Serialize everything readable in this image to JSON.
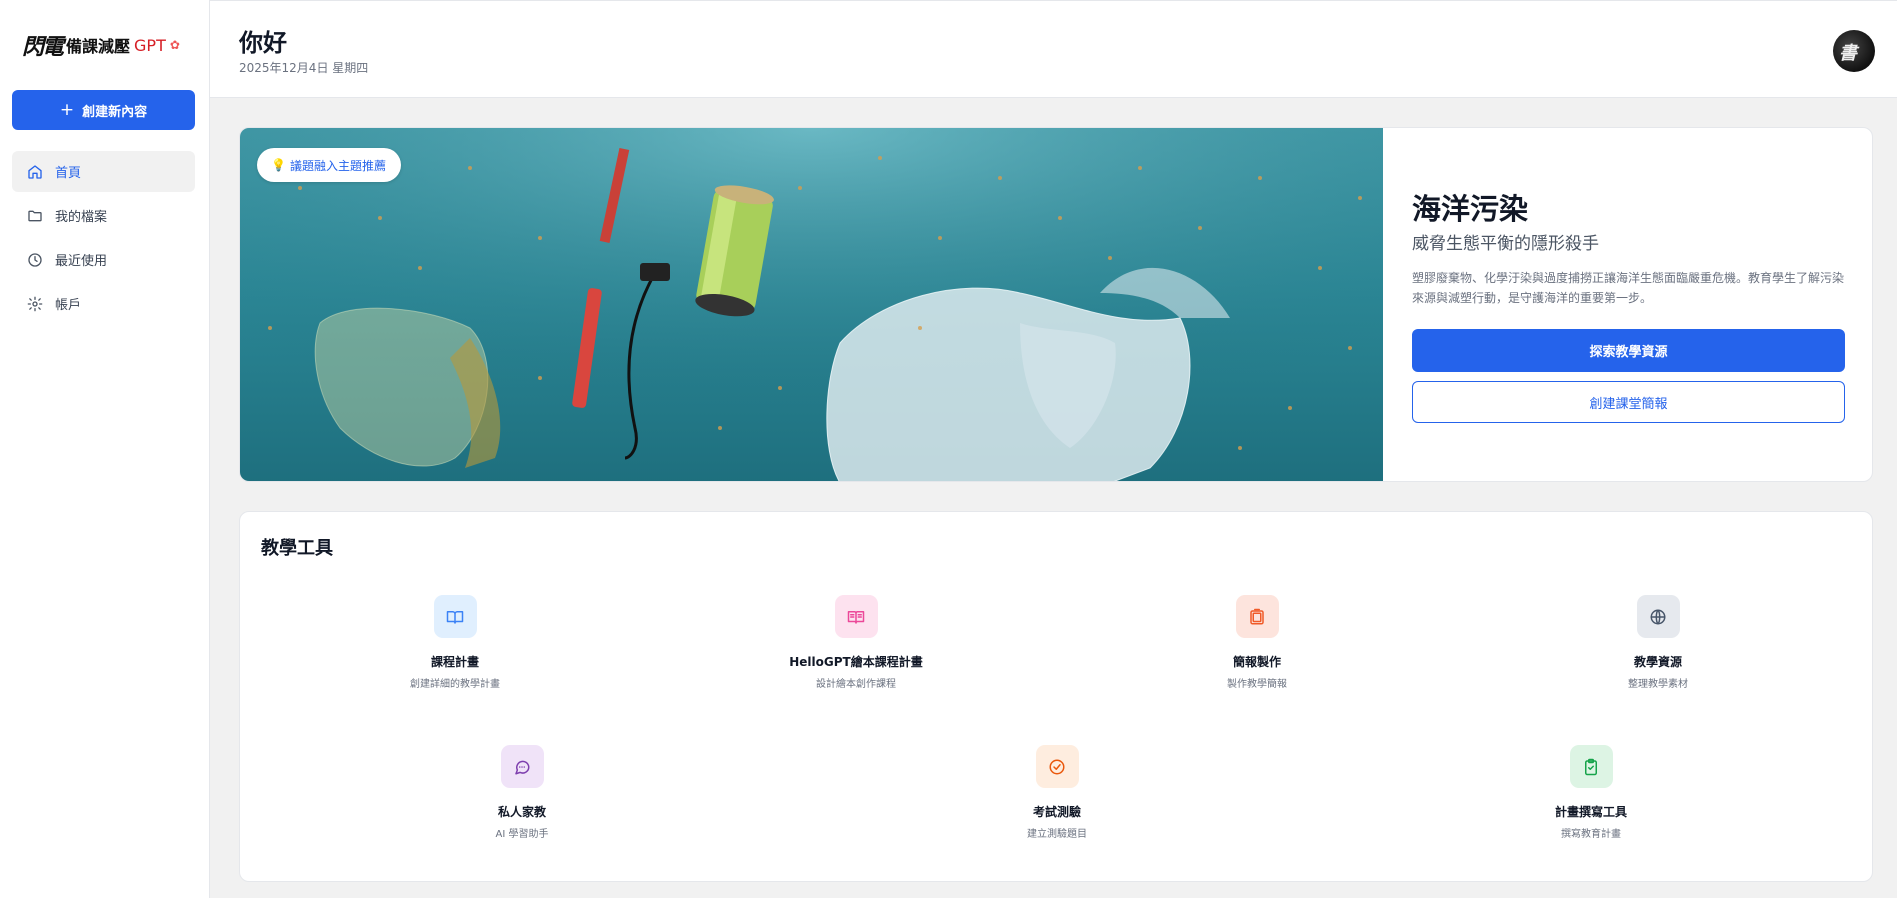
{
  "app": {
    "logo_mark": "閃電",
    "logo_text": "備課減壓",
    "logo_gpt": "GPT",
    "logo_flower": "✿"
  },
  "sidebar": {
    "create_label": "創建新內容",
    "items": [
      {
        "label": "首頁",
        "icon": "home-icon",
        "active": true
      },
      {
        "label": "我的檔案",
        "icon": "folder-icon",
        "active": false
      },
      {
        "label": "最近使用",
        "icon": "clock-icon",
        "active": false
      },
      {
        "label": "帳戶",
        "icon": "gear-icon",
        "active": false
      }
    ]
  },
  "header": {
    "greeting": "你好",
    "date": "2025年12月4日 星期四"
  },
  "hero": {
    "tag_icon": "💡",
    "tag": "議題融入主題推薦",
    "title": "海洋污染",
    "subtitle": "威脅生態平衡的隱形殺手",
    "description": "塑膠廢棄物、化學汙染與過度捕撈正讓海洋生態面臨嚴重危機。教育學生了解污染來源與減塑行動，是守護海洋的重要第一步。",
    "primary_button": "探索教學資源",
    "secondary_button": "創建課堂簡報"
  },
  "tools": {
    "title": "教學工具",
    "items": [
      {
        "name": "課程計畫",
        "desc": "創建詳細的教學計畫",
        "icon": "book-open-icon",
        "bg": "#e0effe",
        "color": "#3b82f6"
      },
      {
        "name": "HelloGPT繪本課程計畫",
        "desc": "設計繪本創作課程",
        "icon": "picture-book-icon",
        "bg": "#fde2ef",
        "color": "#ec4899"
      },
      {
        "name": "簡報製作",
        "desc": "製作教學簡報",
        "icon": "slides-icon",
        "bg": "#fde4dd",
        "color": "#f05a28"
      },
      {
        "name": "教學資源",
        "desc": "整理教學素材",
        "icon": "globe-icon",
        "bg": "#e6e9ee",
        "color": "#475569"
      },
      {
        "name": "私人家教",
        "desc": "AI 學習助手",
        "icon": "chat-icon",
        "bg": "#f0e3f8",
        "color": "#7e3fae"
      },
      {
        "name": "考試測驗",
        "desc": "建立測驗題目",
        "icon": "check-circle-icon",
        "bg": "#feeddf",
        "color": "#ea580c"
      },
      {
        "name": "計畫撰寫工具",
        "desc": "撰寫教育計畫",
        "icon": "clipboard-check-icon",
        "bg": "#ddf4e4",
        "color": "#16a34a"
      }
    ]
  },
  "colors": {
    "accent": "#2563eb",
    "background": "#f1f1f1"
  }
}
